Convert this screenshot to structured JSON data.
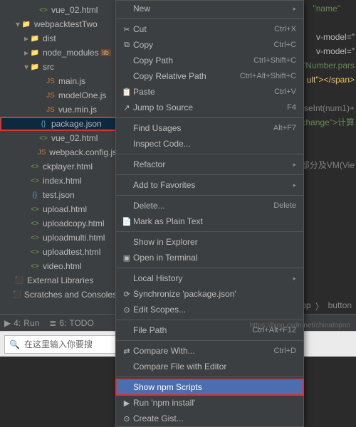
{
  "tree": [
    {
      "indent": 40,
      "arrow": "",
      "icon": "html",
      "label": "vue_02.html"
    },
    {
      "indent": 16,
      "arrow": "▾",
      "icon": "folder",
      "label": "webpacktestTwo"
    },
    {
      "indent": 28,
      "arrow": "▸",
      "icon": "folder",
      "label": "dist"
    },
    {
      "indent": 28,
      "arrow": "▸",
      "icon": "folder",
      "label": "node_modules",
      "lib": "lib"
    },
    {
      "indent": 28,
      "arrow": "▾",
      "icon": "folder",
      "label": "src"
    },
    {
      "indent": 50,
      "arrow": "",
      "icon": "js",
      "label": "main.js"
    },
    {
      "indent": 50,
      "arrow": "",
      "icon": "js",
      "label": "modelOne.js"
    },
    {
      "indent": 50,
      "arrow": "",
      "icon": "js",
      "label": "vue.min.js"
    },
    {
      "indent": 40,
      "arrow": "",
      "icon": "json",
      "label": "package.json",
      "hl": true,
      "sel": true
    },
    {
      "indent": 40,
      "arrow": "",
      "icon": "html",
      "label": "vue_02.html"
    },
    {
      "indent": 40,
      "arrow": "",
      "icon": "js",
      "label": "webpack.config.js"
    },
    {
      "indent": 28,
      "arrow": "",
      "icon": "html",
      "label": "ckplayer.html"
    },
    {
      "indent": 28,
      "arrow": "",
      "icon": "html",
      "label": "index.html"
    },
    {
      "indent": 28,
      "arrow": "",
      "icon": "json",
      "label": "test.json"
    },
    {
      "indent": 28,
      "arrow": "",
      "icon": "html",
      "label": "upload.html"
    },
    {
      "indent": 28,
      "arrow": "",
      "icon": "html",
      "label": "uploadcopy.html"
    },
    {
      "indent": 28,
      "arrow": "",
      "icon": "html",
      "label": "uploadmulti.html"
    },
    {
      "indent": 28,
      "arrow": "",
      "icon": "html",
      "label": "uploadtest.html"
    },
    {
      "indent": 28,
      "arrow": "",
      "icon": "html",
      "label": "video.html"
    },
    {
      "indent": 6,
      "arrow": "",
      "icon": "lib",
      "label": "External Libraries"
    },
    {
      "indent": 6,
      "arrow": "",
      "icon": "lib",
      "label": "Scratches and Consoles"
    }
  ],
  "menu": [
    {
      "type": "item",
      "icon": "",
      "label": "New",
      "sub": "▸"
    },
    {
      "type": "sep"
    },
    {
      "type": "item",
      "icon": "✂",
      "label": "Cut",
      "short": "Ctrl+X"
    },
    {
      "type": "item",
      "icon": "⧉",
      "label": "Copy",
      "short": "Ctrl+C"
    },
    {
      "type": "item",
      "icon": "",
      "label": "Copy Path",
      "short": "Ctrl+Shift+C"
    },
    {
      "type": "item",
      "icon": "",
      "label": "Copy Relative Path",
      "short": "Ctrl+Alt+Shift+C"
    },
    {
      "type": "item",
      "icon": "📋",
      "label": "Paste",
      "short": "Ctrl+V"
    },
    {
      "type": "item",
      "icon": "↗",
      "label": "Jump to Source",
      "short": "F4"
    },
    {
      "type": "sep"
    },
    {
      "type": "item",
      "icon": "",
      "label": "Find Usages",
      "short": "Alt+F7"
    },
    {
      "type": "item",
      "icon": "",
      "label": "Inspect Code..."
    },
    {
      "type": "sep"
    },
    {
      "type": "item",
      "icon": "",
      "label": "Refactor",
      "sub": "▸"
    },
    {
      "type": "sep"
    },
    {
      "type": "item",
      "icon": "",
      "label": "Add to Favorites",
      "sub": "▸"
    },
    {
      "type": "sep"
    },
    {
      "type": "item",
      "icon": "",
      "label": "Delete...",
      "short": "Delete"
    },
    {
      "type": "item",
      "icon": "📄",
      "label": "Mark as Plain Text"
    },
    {
      "type": "sep"
    },
    {
      "type": "item",
      "icon": "",
      "label": "Show in Explorer"
    },
    {
      "type": "item",
      "icon": "▣",
      "label": "Open in Terminal"
    },
    {
      "type": "sep"
    },
    {
      "type": "item",
      "icon": "",
      "label": "Local History",
      "sub": "▸"
    },
    {
      "type": "item",
      "icon": "⟳",
      "label": "Synchronize 'package.json'"
    },
    {
      "type": "item",
      "icon": "⊙",
      "label": "Edit Scopes..."
    },
    {
      "type": "sep"
    },
    {
      "type": "item",
      "icon": "",
      "label": "File Path",
      "short": "Ctrl+Alt+F12"
    },
    {
      "type": "sep"
    },
    {
      "type": "item",
      "icon": "⇄",
      "label": "Compare With...",
      "short": "Ctrl+D"
    },
    {
      "type": "item",
      "icon": "",
      "label": "Compare File with Editor"
    },
    {
      "type": "sep"
    },
    {
      "type": "item",
      "icon": "",
      "label": "Show npm Scripts",
      "sel": true
    },
    {
      "type": "item",
      "icon": "▶",
      "label": "Run 'npm install'"
    },
    {
      "type": "item",
      "icon": "⊙",
      "label": "Create Gist..."
    }
  ],
  "code": {
    "l1": "\"name\"",
    "l2": "v-model=\"",
    "l3": "v-model=\"",
    "l4": "\"Number.pars",
    "l5": "ult\"></span>",
    "l6": "seInt(num1)+",
    "l7": "\"change\">计算",
    "l8": "el部分及VM(Vie"
  },
  "breadcrumb": {
    "a": "app",
    "b": "button"
  },
  "bottom": {
    "run_num": "4:",
    "run": "Run",
    "todo_num": "6:",
    "todo": "TODO"
  },
  "taskbar": {
    "search_placeholder": "在这里输入你要搜"
  },
  "watermark": "https://blog.csdn.net/chinatopno"
}
